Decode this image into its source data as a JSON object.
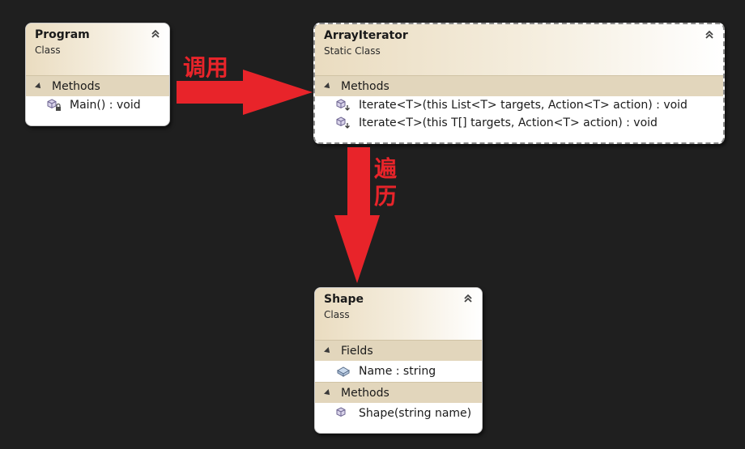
{
  "classes": {
    "program": {
      "name": "Program",
      "kind": "Class",
      "methods_title": "Methods",
      "methods": [
        "Main() : void"
      ]
    },
    "array_iterator": {
      "name": "ArrayIterator",
      "kind": "Static Class",
      "methods_title": "Methods",
      "methods": [
        "Iterate<T>(this List<T> targets, Action<T> action) : void",
        "Iterate<T>(this T[] targets, Action<T> action) : void"
      ]
    },
    "shape": {
      "name": "Shape",
      "kind": "Class",
      "fields_title": "Fields",
      "fields": [
        "Name : string"
      ],
      "methods_title": "Methods",
      "methods": [
        "Shape(string name)"
      ]
    }
  },
  "annotations": {
    "call": "调用",
    "traverse": "遍历"
  },
  "icons": {
    "collapse": "double-chevron-up-icon",
    "method_private": "method-lock-icon",
    "method_extension": "extension-method-icon",
    "field": "field-icon",
    "method": "method-icon"
  },
  "colors": {
    "background": "#1f1f1f",
    "header_gradient_start": "#eadcc0",
    "section": "#e2d6bc",
    "arrow": "#e8242a"
  }
}
